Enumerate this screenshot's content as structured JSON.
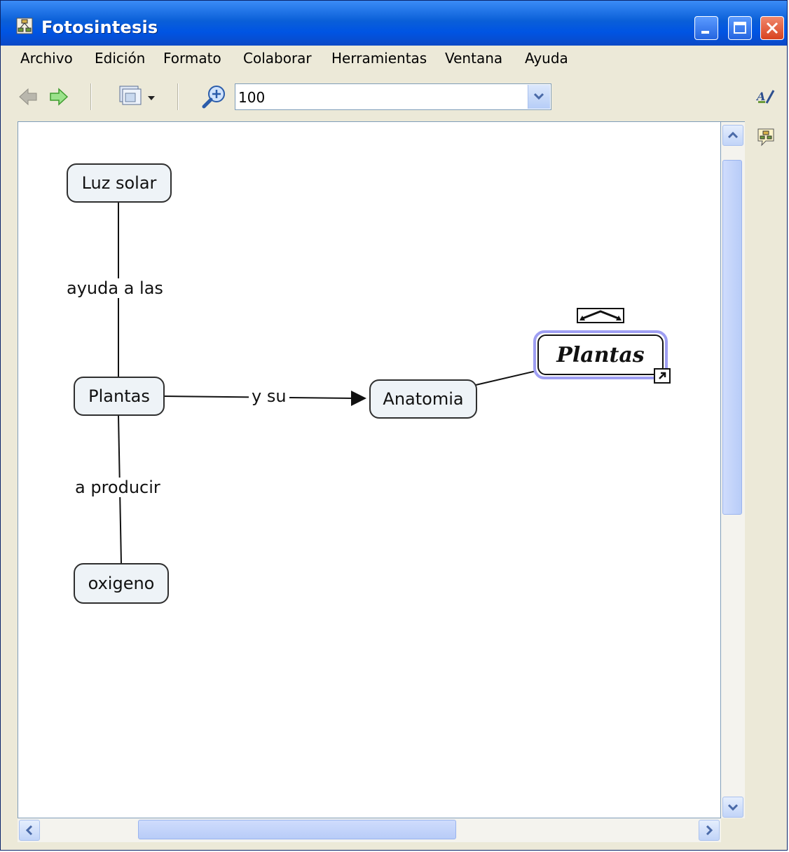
{
  "window": {
    "title": "Fotosintesis",
    "accent": "#0054e3"
  },
  "menu": {
    "items": [
      {
        "label": "Archivo"
      },
      {
        "label": "Edición"
      },
      {
        "label": "Formato"
      },
      {
        "label": "Colaborar"
      },
      {
        "label": "Herramientas"
      },
      {
        "label": "Ventana"
      },
      {
        "label": "Ayuda"
      }
    ]
  },
  "toolbar": {
    "zoom_value": "100",
    "icons": [
      "back-arrow-icon",
      "forward-arrow-icon",
      "view-options-icon",
      "zoom-icon",
      "zoom-dropdown-icon"
    ]
  },
  "side_icons": [
    "styles-icon",
    "collaboration-icon"
  ],
  "map": {
    "concepts": [
      {
        "id": "luz",
        "label": "Luz solar"
      },
      {
        "id": "plantas",
        "label": "Plantas"
      },
      {
        "id": "oxigeno",
        "label": "oxigeno"
      },
      {
        "id": "anatomia",
        "label": "Anatomia"
      },
      {
        "id": "plantas_link",
        "label": "Plantas"
      }
    ],
    "links": [
      {
        "label": "ayuda a las"
      },
      {
        "label": "a producir"
      },
      {
        "label": "y su"
      }
    ]
  }
}
